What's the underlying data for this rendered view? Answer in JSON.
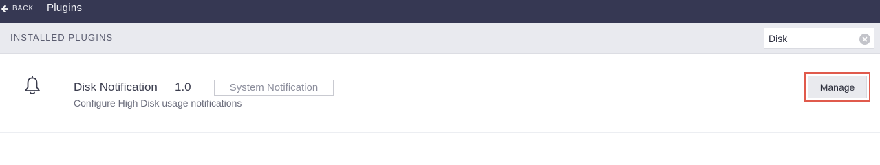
{
  "topbar": {
    "back_label": "BACK",
    "title": "Plugins"
  },
  "section": {
    "title": "INSTALLED PLUGINS"
  },
  "search": {
    "value": "Disk"
  },
  "plugins": [
    {
      "icon": "bell-icon",
      "name": "Disk Notification",
      "version": "1.0",
      "category": "System Notification",
      "description": "Configure High Disk usage notifications",
      "action_label": "Manage"
    }
  ],
  "colors": {
    "topbar_bg": "#363853",
    "section_bg": "#e9eaef",
    "highlight_outline": "#e05a4c"
  }
}
